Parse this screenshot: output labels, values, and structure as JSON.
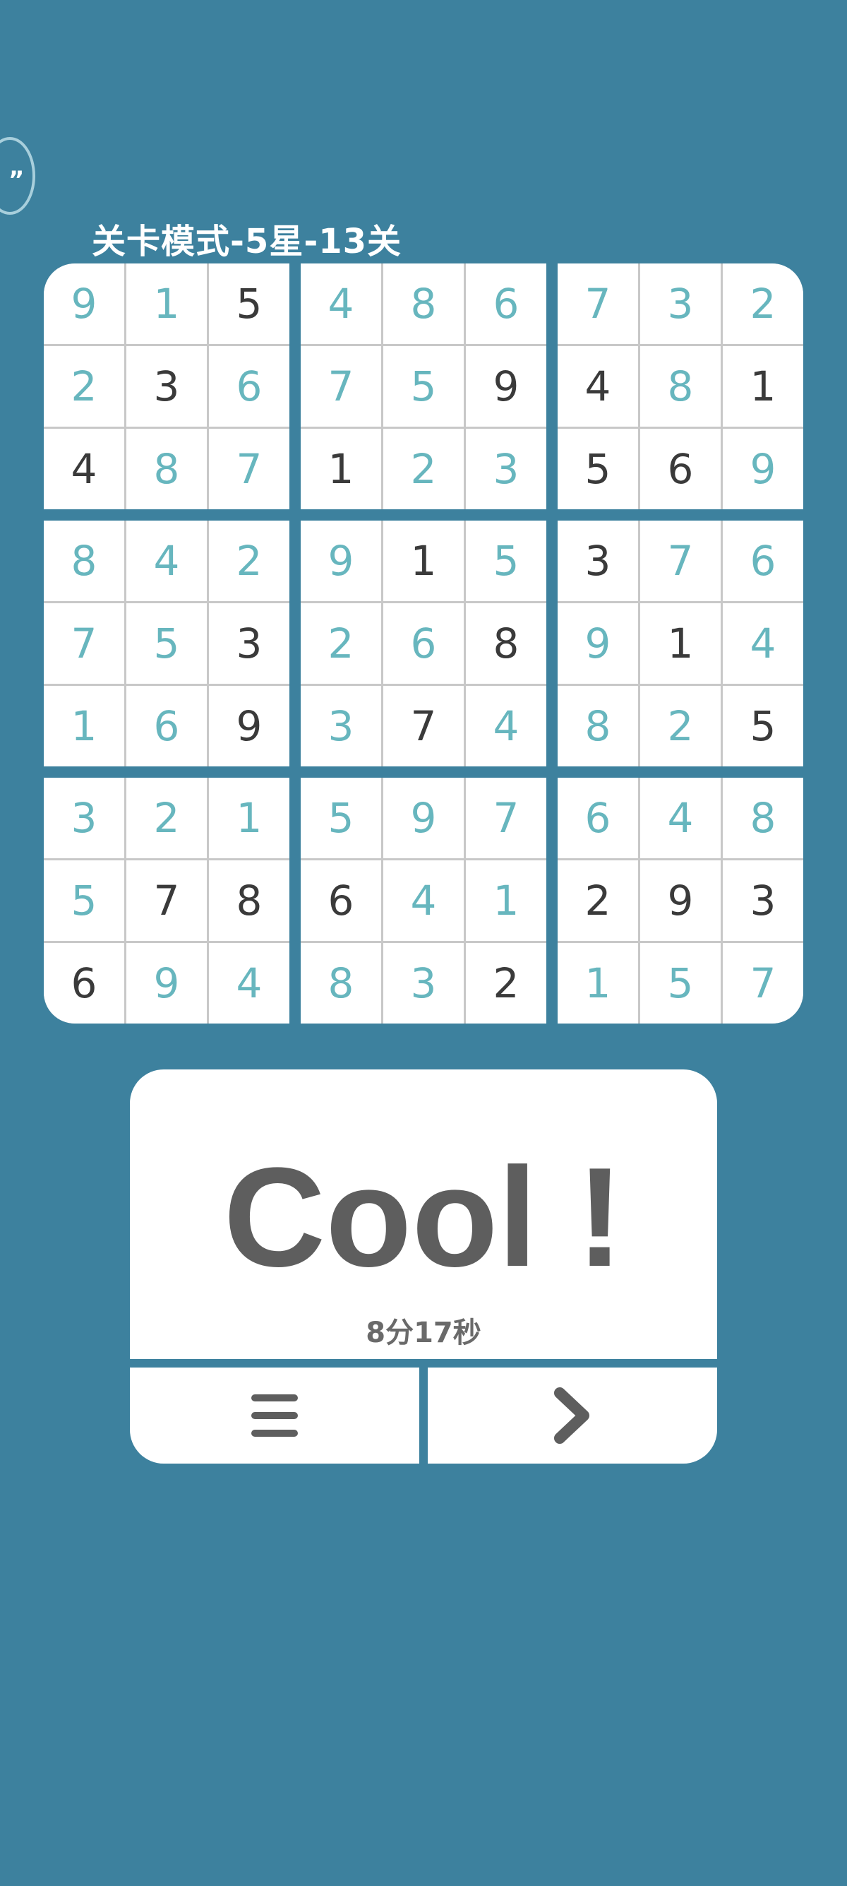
{
  "header": {
    "float_button_glyph": "”",
    "level_title": "关卡模式-5星-13关"
  },
  "board": {
    "colors": {
      "given": "#3a3a3a",
      "filled": "#67b6be",
      "grid_line": "#c8c8c8",
      "cell_bg": "#ffffff"
    },
    "rows": [
      [
        9,
        1,
        5,
        4,
        8,
        6,
        7,
        3,
        2
      ],
      [
        2,
        3,
        6,
        7,
        5,
        9,
        4,
        8,
        1
      ],
      [
        4,
        8,
        7,
        1,
        2,
        3,
        5,
        6,
        9
      ],
      [
        8,
        4,
        2,
        9,
        1,
        5,
        3,
        7,
        6
      ],
      [
        7,
        5,
        3,
        2,
        6,
        8,
        9,
        1,
        4
      ],
      [
        1,
        6,
        9,
        3,
        7,
        4,
        8,
        2,
        5
      ],
      [
        3,
        2,
        1,
        5,
        9,
        7,
        6,
        4,
        8
      ],
      [
        5,
        7,
        8,
        6,
        4,
        1,
        2,
        9,
        3
      ],
      [
        6,
        9,
        4,
        8,
        3,
        2,
        1,
        5,
        7
      ]
    ],
    "given": [
      [
        0,
        0,
        1,
        0,
        0,
        0,
        0,
        0,
        0
      ],
      [
        0,
        1,
        0,
        0,
        0,
        1,
        1,
        0,
        1
      ],
      [
        1,
        0,
        0,
        1,
        0,
        0,
        1,
        1,
        0
      ],
      [
        0,
        0,
        0,
        0,
        1,
        0,
        1,
        0,
        0
      ],
      [
        0,
        0,
        1,
        0,
        0,
        1,
        0,
        1,
        0
      ],
      [
        0,
        0,
        1,
        0,
        1,
        0,
        0,
        0,
        1
      ],
      [
        0,
        0,
        0,
        0,
        0,
        0,
        0,
        0,
        0
      ],
      [
        0,
        1,
        1,
        1,
        0,
        0,
        1,
        1,
        1
      ],
      [
        1,
        0,
        0,
        0,
        0,
        1,
        0,
        0,
        0
      ]
    ]
  },
  "result": {
    "headline": "Cool !",
    "time": "8分17秒"
  },
  "actions": {
    "menu_icon": "menu-icon",
    "next_icon": "chevron-right-icon"
  },
  "colors": {
    "background": "#3d819e",
    "card": "#ffffff",
    "headline": "#5e5e5e",
    "icon": "#5e5e5e"
  }
}
